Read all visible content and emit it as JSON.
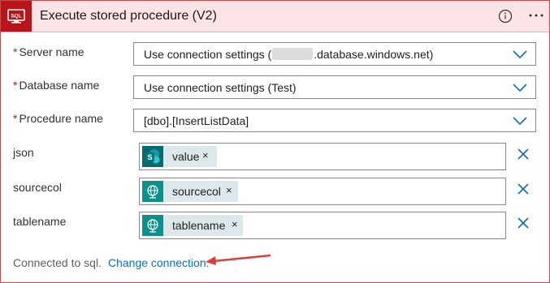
{
  "header": {
    "title": "Execute stored procedure (V2)",
    "tile_icon": "sql-icon",
    "tile_text": "SQL",
    "brand_color": "#ba141a"
  },
  "fields": [
    {
      "label": "Server name",
      "required": true,
      "value_prefix": "Use connection settings (",
      "value_suffix": ".database.windows.net)"
    },
    {
      "label": "Database name",
      "required": true,
      "value": "Use connection settings (Test)"
    },
    {
      "label": "Procedure name",
      "required": true,
      "value": "[dbo].[InsertListData]"
    }
  ],
  "params": [
    {
      "label": "json",
      "token": "value",
      "token_icon": "sharepoint-icon",
      "token_color": "#036c70"
    },
    {
      "label": "sourcecol",
      "token": "sourcecol",
      "token_icon": "globe-icon",
      "token_color": "#0c9089"
    },
    {
      "label": "tablename",
      "token": "tablename",
      "token_icon": "globe-icon",
      "token_color": "#0c9089"
    }
  ],
  "footer": {
    "connected_text": "Connected to sql.",
    "change_link": "Change connection."
  },
  "required_marker": "*",
  "token_close": "×"
}
